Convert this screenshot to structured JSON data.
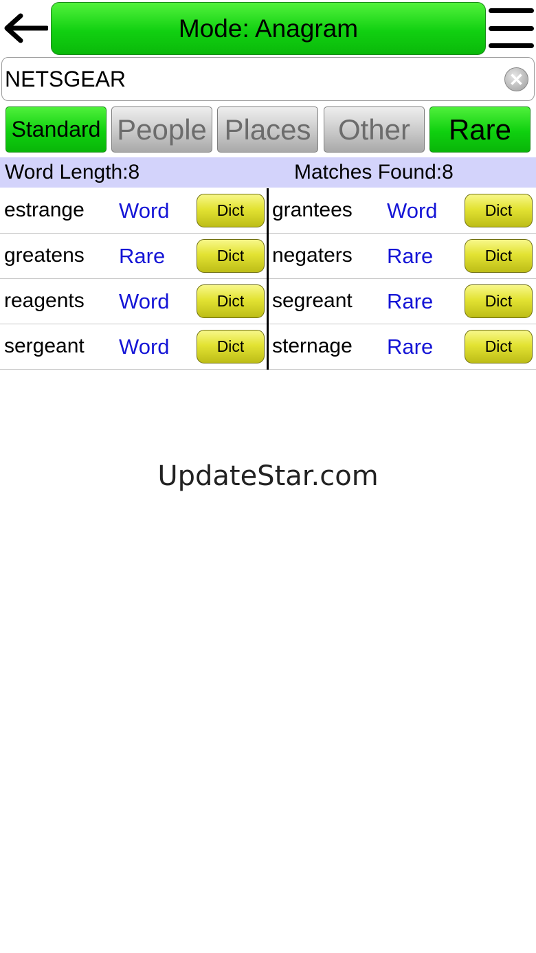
{
  "header": {
    "mode_label": "Mode: Anagram"
  },
  "search": {
    "value": "NETSGEAR"
  },
  "filters": [
    {
      "label": "Standard",
      "active": true
    },
    {
      "label": "People",
      "active": false
    },
    {
      "label": "Places",
      "active": false
    },
    {
      "label": "Other",
      "active": false
    },
    {
      "label": "Rare",
      "active": true
    }
  ],
  "info": {
    "word_length": "Word Length:8",
    "matches_found": "Matches Found:8"
  },
  "results": [
    {
      "word": "estrange",
      "type": "Word",
      "dict": "Dict"
    },
    {
      "word": "grantees",
      "type": "Word",
      "dict": "Dict"
    },
    {
      "word": "greatens",
      "type": "Rare",
      "dict": "Dict"
    },
    {
      "word": "negaters",
      "type": "Rare",
      "dict": "Dict"
    },
    {
      "word": "reagents",
      "type": "Word",
      "dict": "Dict"
    },
    {
      "word": "segreant",
      "type": "Rare",
      "dict": "Dict"
    },
    {
      "word": "sergeant",
      "type": "Word",
      "dict": "Dict"
    },
    {
      "word": "sternage",
      "type": "Rare",
      "dict": "Dict"
    }
  ],
  "watermark": "UpdateStar.com",
  "colors": {
    "active_green": "#11d011",
    "inactive_gray": "#c9c9c9",
    "info_bar": "#d3d3fb",
    "type_link": "#1515d6",
    "dict_yellow": "#e3e333"
  },
  "icons": {
    "back": "arrow-left-icon",
    "menu": "hamburger-menu-icon",
    "clear": "clear-circle-x-icon"
  }
}
